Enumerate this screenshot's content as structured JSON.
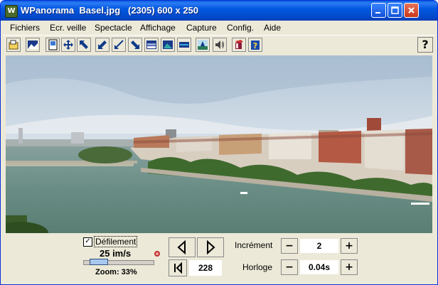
{
  "window": {
    "title": "WPanorama  Basel.jpg   (2305) 600 x 250",
    "app_icon_glyph": "W"
  },
  "menu": {
    "items": [
      "Fichiers",
      "Ecr. veille",
      "Spectacle",
      "Affichage",
      "Capture",
      "Config.",
      "Aide"
    ]
  },
  "toolbar": {
    "help_label": "?",
    "icons": [
      "open-icon",
      "picture-icon",
      "page-icon",
      "move-all-icon",
      "arrow-upleft-icon",
      "arrow-downleft-icon",
      "arrow-downleft2-icon",
      "arrow-downright-icon",
      "panorama-1-icon",
      "panorama-2-icon",
      "panorama-3-icon",
      "sunset-icon",
      "sound-icon",
      "book-icon",
      "help-book-icon"
    ]
  },
  "controls": {
    "scroll_label": "Défilement",
    "scroll_checked": true,
    "speed": "25 im/s",
    "zoom": "Zoom: 33%",
    "zoom_fraction": 0.33,
    "position_value": "228",
    "increment_label": "Incrément",
    "increment_value": "2",
    "clock_label": "Horloge",
    "clock_value": "0.04s",
    "minus": "−",
    "plus": "+",
    "check_mark": "✓"
  },
  "colors": {
    "titlebar": "#0358e0",
    "window_bg": "#ece9d8",
    "sky": "#c9d8e6",
    "water": "#6a8e86"
  }
}
